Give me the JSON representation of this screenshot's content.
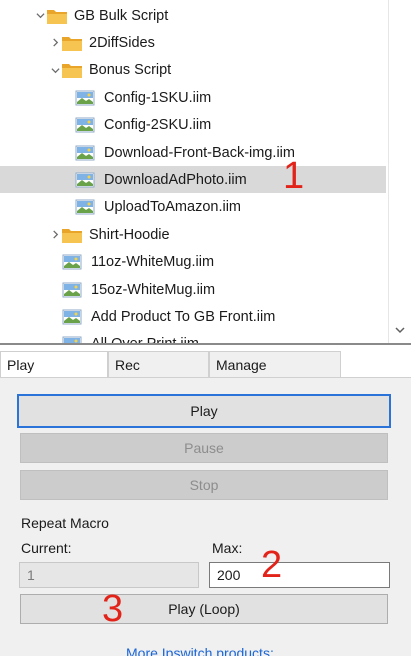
{
  "tree": {
    "items": [
      {
        "label": "GB Bulk Script",
        "kind": "folder",
        "chevron": "down",
        "depth": 0
      },
      {
        "label": "2DiffSides",
        "kind": "folder",
        "chevron": "right",
        "depth": 1
      },
      {
        "label": "Bonus Script",
        "kind": "folder",
        "chevron": "down",
        "depth": 1
      },
      {
        "label": "Config-1SKU.iim",
        "kind": "macro",
        "depth": 2
      },
      {
        "label": "Config-2SKU.iim",
        "kind": "macro",
        "depth": 2
      },
      {
        "label": "Download-Front-Back-img.iim",
        "kind": "macro",
        "depth": 2
      },
      {
        "label": "DownloadAdPhoto.iim",
        "kind": "macro",
        "depth": 2,
        "selected": true
      },
      {
        "label": "UploadToAmazon.iim",
        "kind": "macro",
        "depth": 2
      },
      {
        "label": "Shirt-Hoodie",
        "kind": "folder",
        "chevron": "right",
        "depth": 1
      },
      {
        "label": "11oz-WhiteMug.iim",
        "kind": "macro",
        "depth": 1
      },
      {
        "label": "15oz-WhiteMug.iim",
        "kind": "macro",
        "depth": 1
      },
      {
        "label": "Add Product To GB Front.iim",
        "kind": "macro",
        "depth": 1
      },
      {
        "label": "All Over Print.iim",
        "kind": "macro",
        "depth": 1
      }
    ]
  },
  "tabs": {
    "play": "Play",
    "rec": "Rec",
    "manage": "Manage"
  },
  "buttons": {
    "play": "Play",
    "pause": "Pause",
    "stop": "Stop",
    "play_loop": "Play (Loop)"
  },
  "repeat": {
    "title": "Repeat Macro",
    "current_label": "Current:",
    "max_label": "Max:",
    "current_value": "1",
    "max_value": "200"
  },
  "more_link": "More Ipswitch products:",
  "annotations": {
    "a1": "1",
    "a2": "2",
    "a3": "3"
  },
  "colors": {
    "accent": "#2a73d9",
    "annotation": "#e2231a",
    "selection": "#d9d9d9",
    "folder": "#e8a52a"
  }
}
